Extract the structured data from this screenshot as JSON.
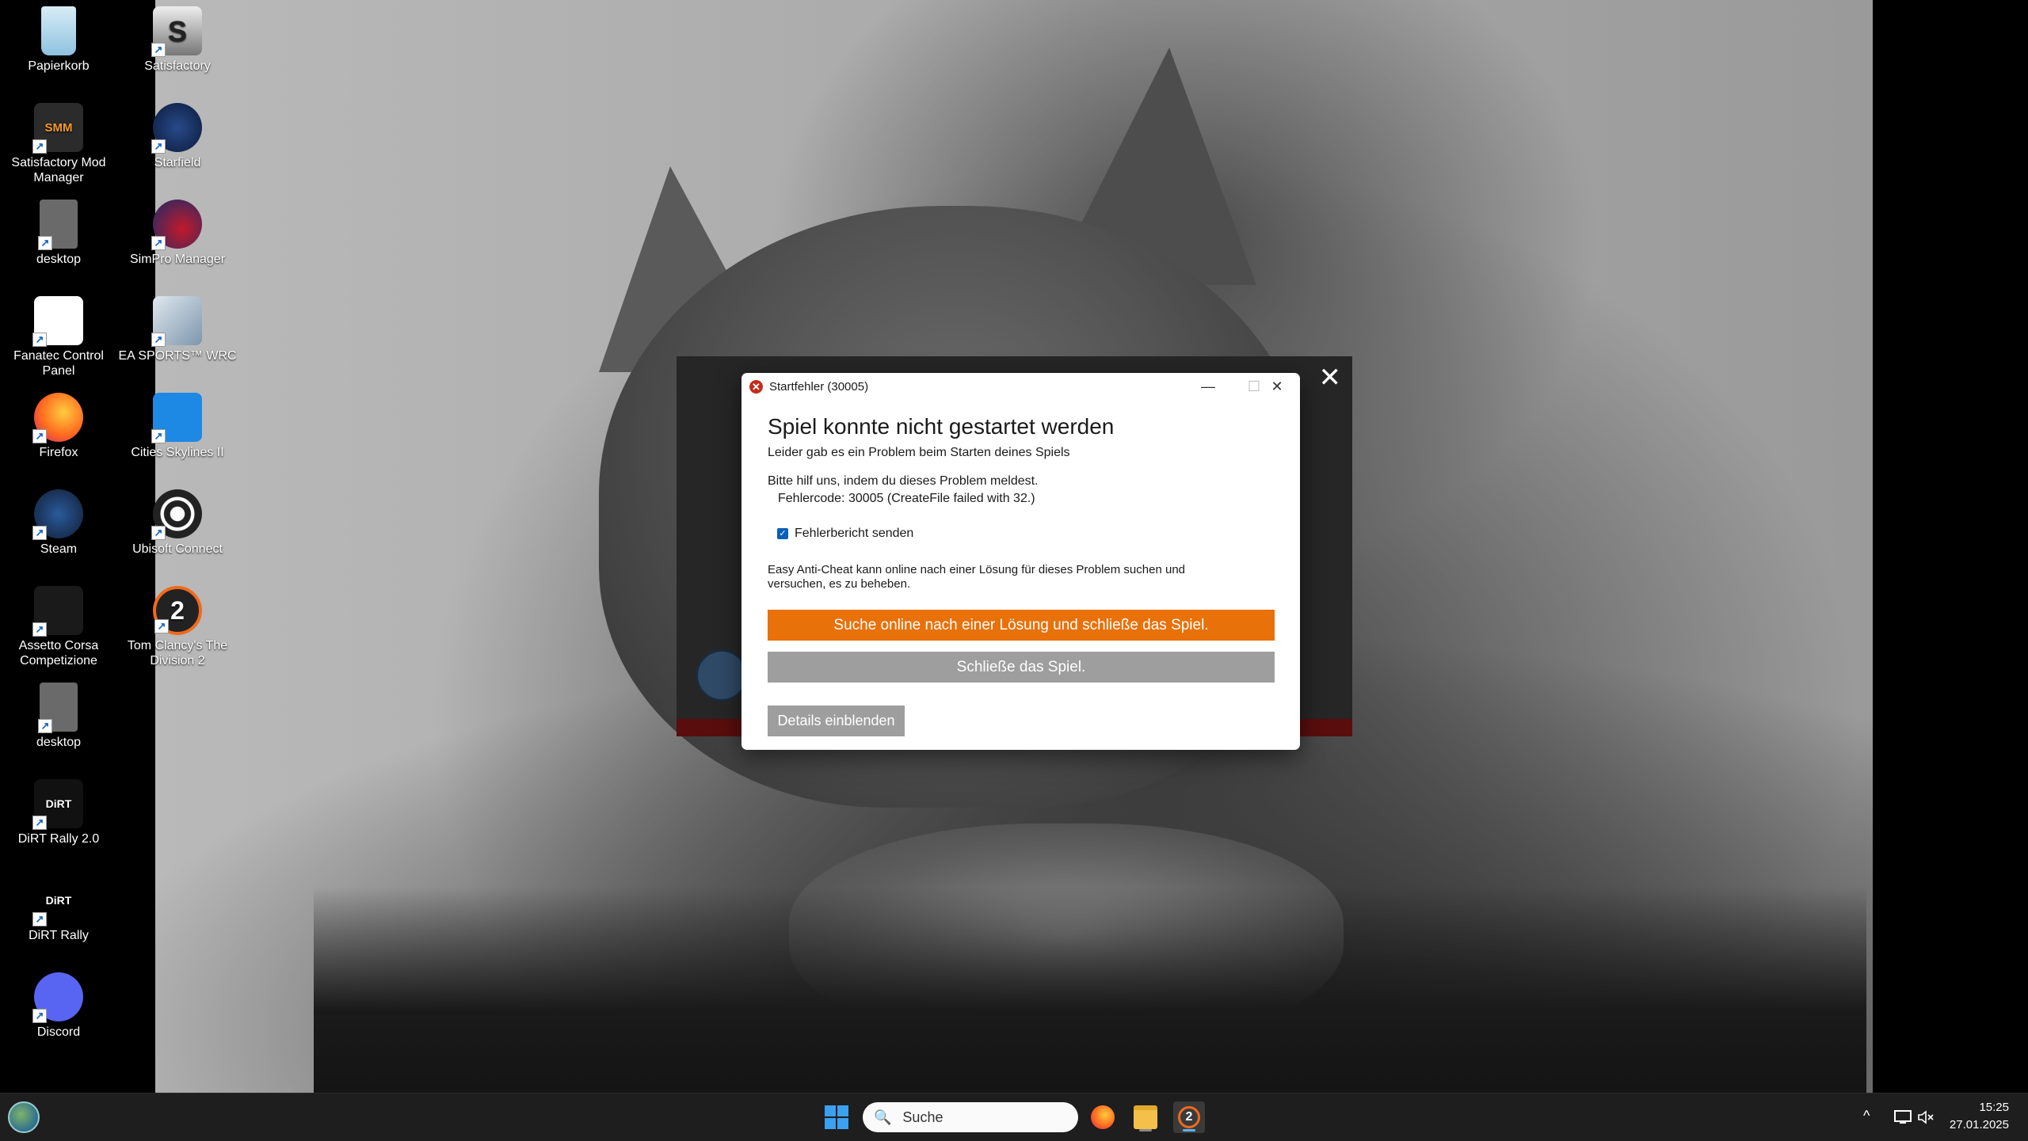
{
  "desktop": {
    "icons_col1": [
      {
        "label": "Papierkorb",
        "icon": "recycle-bin-icon"
      },
      {
        "label": "Satisfactory Mod Manager",
        "icon": "smm-icon",
        "badge": "SMM"
      },
      {
        "label": "desktop",
        "icon": "settings-file-icon"
      },
      {
        "label": "Fanatec Control Panel",
        "icon": "fanatec-icon"
      },
      {
        "label": "Firefox",
        "icon": "firefox-icon"
      },
      {
        "label": "Steam",
        "icon": "steam-icon"
      },
      {
        "label": "Assetto Corsa Competizione",
        "icon": "acc-icon"
      },
      {
        "label": "desktop",
        "icon": "settings-file-icon"
      },
      {
        "label": "DiRT Rally 2.0",
        "icon": "dirt-rally-2-icon",
        "badge": "DiRT"
      },
      {
        "label": "DiRT Rally",
        "icon": "dirt-rally-icon",
        "badge": "DiRT"
      },
      {
        "label": "Discord",
        "icon": "discord-icon"
      }
    ],
    "icons_col2": [
      {
        "label": "Satisfactory",
        "icon": "satisfactory-icon",
        "badge": "S"
      },
      {
        "label": "Starfield",
        "icon": "starfield-icon"
      },
      {
        "label": "SimPro Manager",
        "icon": "simpro-icon"
      },
      {
        "label": "EA SPORTS™ WRC",
        "icon": "ea-wrc-icon"
      },
      {
        "label": "Cities Skylines II",
        "icon": "cities-skylines-icon"
      },
      {
        "label": "Ubisoft Connect",
        "icon": "ubisoft-icon"
      },
      {
        "label": "Tom Clancy's The Division 2",
        "icon": "division2-icon",
        "badge": "2"
      }
    ]
  },
  "launcher": {
    "close_glyph": "✕"
  },
  "dialog": {
    "title": "Startfehler (30005)",
    "heading": "Spiel konnte nicht gestartet werden",
    "subtitle": "Leider gab es ein Problem beim Starten deines Spiels",
    "help_text": "Bitte hilf uns, indem du dieses Problem meldest.",
    "error_code": "Fehlercode: 30005 (CreateFile failed with 32.)",
    "checkbox_label": "Fehlerbericht senden",
    "checkbox_checked": true,
    "eac_text_line1": "Easy Anti-Cheat kann online nach einer Lösung für dieses Problem suchen und",
    "eac_text_line2": "versuchen, es zu beheben.",
    "primary_button": "Suche online nach einer Lösung und schließe das Spiel.",
    "secondary_button": "Schließe das Spiel.",
    "details_button": "Details einblenden",
    "minimize_glyph": "—",
    "maximize_glyph": "☐",
    "close_glyph": "✕",
    "accent_color": "#e8710a"
  },
  "taskbar": {
    "search_placeholder": "Suche",
    "time": "15:25",
    "date": "27.01.2025",
    "tray_chevron": "^",
    "pinned": [
      "windows-start-icon",
      "firefox-icon",
      "file-explorer-icon",
      "division2-icon"
    ]
  }
}
